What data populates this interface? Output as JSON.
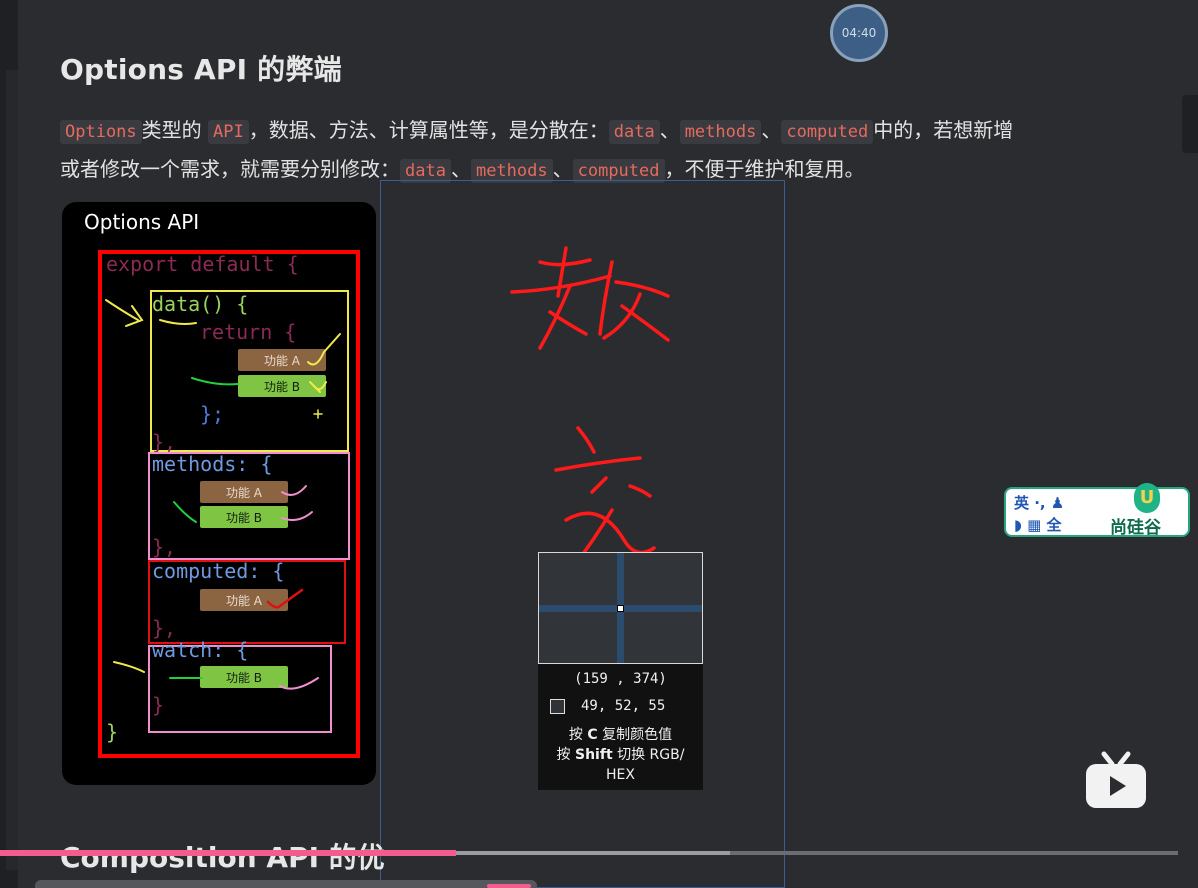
{
  "timer": "04:40",
  "section_title": "Options API 的弊端",
  "paragraph": {
    "line1": [
      {
        "code": "Options"
      },
      {
        "text": "类型的 "
      },
      {
        "code": "API"
      },
      {
        "text": "，数据、方法、计算属性等，是分散在："
      },
      {
        "code": "data"
      },
      {
        "text": "、"
      },
      {
        "code": "methods"
      },
      {
        "text": "、"
      },
      {
        "code": "computed"
      },
      {
        "text": "中的，若想新增"
      }
    ],
    "line2": [
      {
        "text": "或者修改一个需求，就需要分别修改："
      },
      {
        "code": "data"
      },
      {
        "text": "、"
      },
      {
        "code": "methods"
      },
      {
        "text": "、"
      },
      {
        "code": "computed"
      },
      {
        "text": "，不便于维护和复用。"
      }
    ]
  },
  "figure": {
    "title": "Options API",
    "code": {
      "export": "export default {",
      "data": "data() {",
      "return": "return {",
      "return_close": "};",
      "data_close": "},",
      "methods": "methods: {",
      "methods_close": "},",
      "computed": "computed: {",
      "computed_close": "},",
      "watch": "watch: {",
      "watch_close": "}",
      "export_close": "}"
    },
    "pills": {
      "data_a": "功能 A",
      "data_b": "功能 B",
      "methods_a": "功能 A",
      "methods_b": "功能 B",
      "computed_a": "功能 A",
      "watch_b": "功能 B"
    }
  },
  "annotation_chars": [
    "数",
    "交"
  ],
  "color_picker": {
    "coord": "(159 , 374)",
    "rgb": "49,  52,  55",
    "tip_line1_prefix": "按",
    "tip_line1_key": "C",
    "tip_line1_suffix": "复制颜色值",
    "tip_line2_prefix": "按",
    "tip_line2_key": "Shift",
    "tip_line2_suffix": "切换 RGB/",
    "tip_line3": "HEX"
  },
  "ime": {
    "line1": "英 ·, ♟",
    "line2": "◗ ▦ 全",
    "brand": "尚硅谷",
    "logo": "U"
  },
  "next_section_title": "Composition API 的优",
  "colors": {
    "background": "#2a2c30",
    "code_text": "#e66a5d",
    "progress": "#f25d8e",
    "box_red": "#ff0000",
    "box_yellow": "#f1e94c",
    "box_pink": "#f08fd0"
  }
}
